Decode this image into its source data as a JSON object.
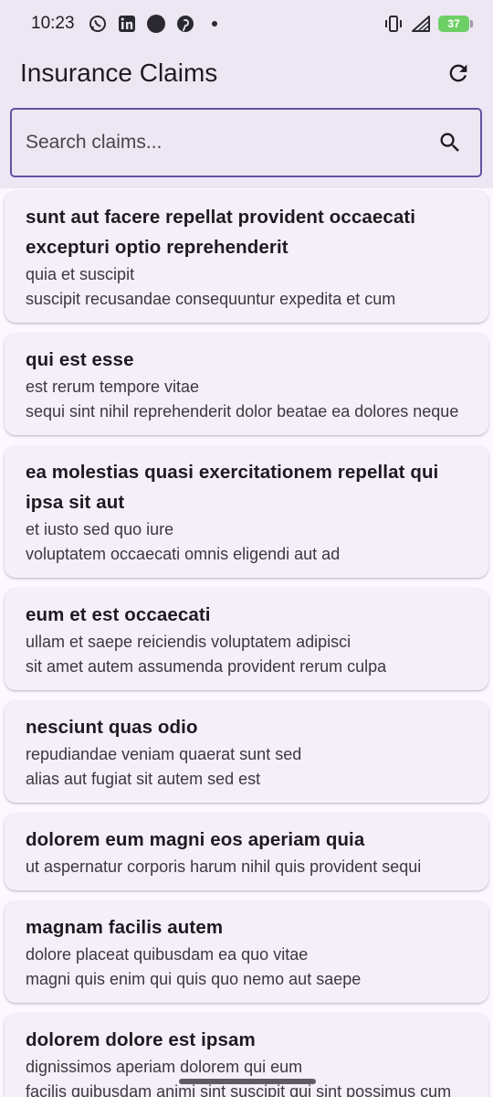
{
  "status_bar": {
    "time": "10:23",
    "battery": "37",
    "icons": [
      "whatsapp-icon",
      "linkedin-icon",
      "circle-icon",
      "pinterest-icon",
      "dot-icon",
      "vibrate-icon",
      "wifi-icon",
      "battery-icon"
    ]
  },
  "app_bar": {
    "title": "Insurance Claims",
    "refresh_icon": "refresh-icon"
  },
  "search": {
    "placeholder": "Search claims...",
    "value": "",
    "icon": "search-icon"
  },
  "claims": [
    {
      "title": "sunt aut facere repellat provident occaecati excepturi optio reprehenderit",
      "line1": "quia et suscipit",
      "line2": "suscipit recusandae consequuntur expedita et cum"
    },
    {
      "title": "qui est esse",
      "line1": "est rerum tempore vitae",
      "line2": "sequi sint nihil reprehenderit dolor beatae ea dolores neque"
    },
    {
      "title": "ea molestias quasi exercitationem repellat qui ipsa sit aut",
      "line1": "et iusto sed quo iure",
      "line2": "voluptatem occaecati omnis eligendi aut ad"
    },
    {
      "title": "eum et est occaecati",
      "line1": "ullam et saepe reiciendis voluptatem adipisci",
      "line2": "sit amet autem assumenda provident rerum culpa"
    },
    {
      "title": "nesciunt quas odio",
      "line1": "repudiandae veniam quaerat sunt sed",
      "line2": "alias aut fugiat sit autem sed est"
    },
    {
      "title": "dolorem eum magni eos aperiam quia",
      "line1": "ut aspernatur corporis harum nihil quis provident sequi",
      "line2": ""
    },
    {
      "title": "magnam facilis autem",
      "line1": "dolore placeat quibusdam ea quo vitae",
      "line2": "magni quis enim qui quis quo nemo aut saepe"
    },
    {
      "title": "dolorem dolore est ipsam",
      "line1": "dignissimos aperiam dolorem qui eum",
      "line2": "facilis quibusdam animi sint suscipit qui sint possimus cum"
    }
  ],
  "colors": {
    "accent": "#6750a4",
    "header_bg": "#ece7f3",
    "card_bg": "#f5effa",
    "battery": "#6fcf67"
  }
}
